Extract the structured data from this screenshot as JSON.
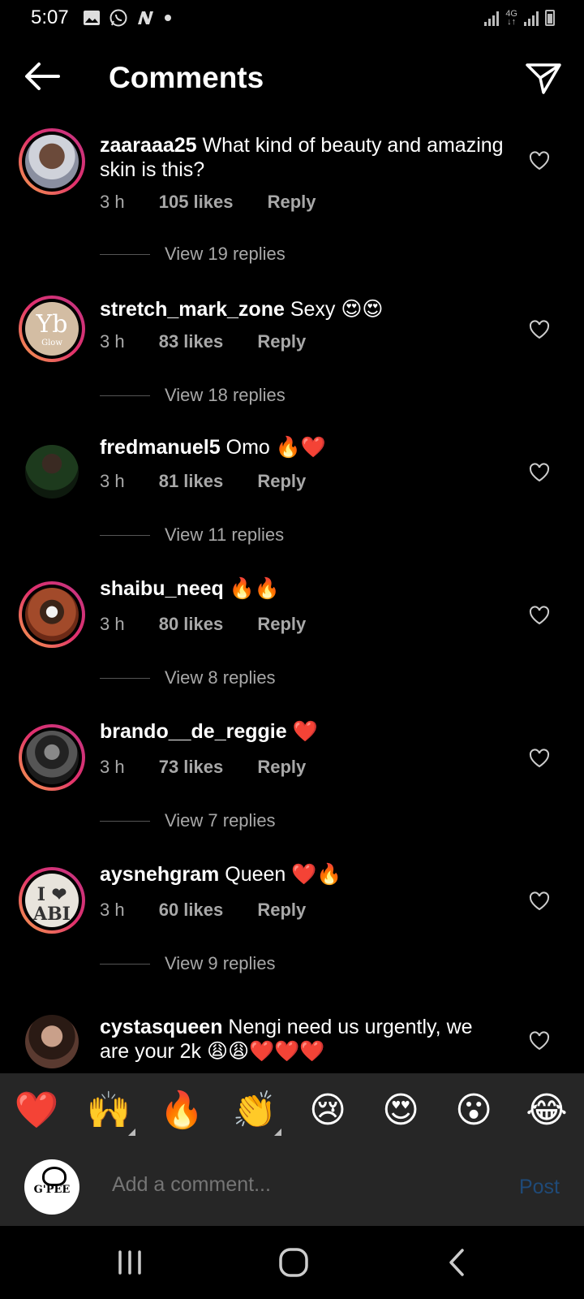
{
  "status_bar": {
    "time": "5:07",
    "network": "4G"
  },
  "header": {
    "title": "Comments"
  },
  "comments": [
    {
      "username": "zaaraaa25",
      "text": "What kind of beauty and amazing skin is this?",
      "time": "3 h",
      "likes": "105 likes",
      "reply": "Reply",
      "view_replies": "View 19 replies"
    },
    {
      "username": "stretch_mark_zone",
      "text": "Sexy 😍😍",
      "time": "3 h",
      "likes": "83 likes",
      "reply": "Reply",
      "view_replies": "View 18 replies",
      "avatar_text": "Yb",
      "avatar_subtext": "Glow"
    },
    {
      "username": "fredmanuel5",
      "text": "Omo 🔥❤️",
      "time": "3 h",
      "likes": "81 likes",
      "reply": "Reply",
      "view_replies": "View 11 replies"
    },
    {
      "username": "shaibu_neeq",
      "text": "🔥🔥",
      "time": "3 h",
      "likes": "80 likes",
      "reply": "Reply",
      "view_replies": "View 8 replies"
    },
    {
      "username": "brando__de_reggie",
      "text": "❤️",
      "time": "3 h",
      "likes": "73 likes",
      "reply": "Reply",
      "view_replies": "View 7 replies"
    },
    {
      "username": "aysnehgram",
      "text": "Queen ❤️🔥",
      "time": "3 h",
      "likes": "60 likes",
      "reply": "Reply",
      "view_replies": "View 9 replies",
      "avatar_text": "I ❤ ABI"
    },
    {
      "username": "cystasqueen",
      "text": "Nengi need us urgently, we are your 2k 😩😩❤️❤️❤️"
    }
  ],
  "emoji_bar": {
    "emojis": [
      "❤️",
      "🙌",
      "🔥",
      "👏",
      "😢",
      "😍",
      "😮",
      "😂"
    ]
  },
  "add_comment": {
    "avatar_text": "G'PEE",
    "placeholder": "Add a comment...",
    "post_label": "Post"
  },
  "colors": {
    "background": "#000000",
    "muted_text": "#a8a8a8",
    "post_disabled": "#1f4a78",
    "bar_background": "#262626",
    "ring_gradient": [
      "#f7a34b",
      "#e1306c",
      "#c13584"
    ]
  }
}
